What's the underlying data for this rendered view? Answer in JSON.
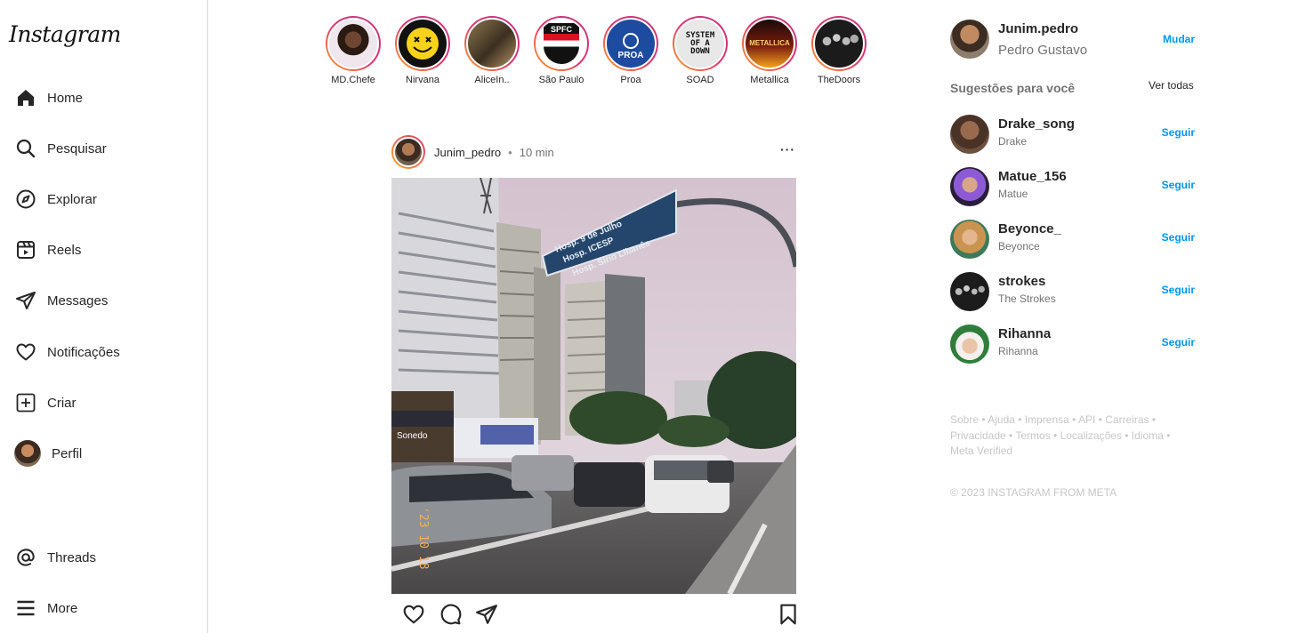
{
  "app": {
    "logo": "Instagram"
  },
  "sidebar": {
    "items": [
      {
        "label": "Home",
        "icon": "home-icon"
      },
      {
        "label": "Pesquisar",
        "icon": "search-icon"
      },
      {
        "label": "Explorar",
        "icon": "compass-icon"
      },
      {
        "label": "Reels",
        "icon": "reels-icon"
      },
      {
        "label": "Messages",
        "icon": "send-icon"
      },
      {
        "label": "Notificações",
        "icon": "heart-icon"
      },
      {
        "label": "Criar",
        "icon": "plus-square-icon"
      },
      {
        "label": "Perfil",
        "icon": "avatar"
      }
    ],
    "bottom": [
      {
        "label": "Threads",
        "icon": "threads-icon"
      },
      {
        "label": "More",
        "icon": "menu-icon"
      }
    ]
  },
  "stories": [
    {
      "name": "MD.Chefe",
      "color": "#e9dfe6"
    },
    {
      "name": "Nirvana",
      "color": "#f7d21a"
    },
    {
      "name": "AliceIn..",
      "color": "#6b5a3a"
    },
    {
      "name": "São Paulo",
      "color": "#d7141c",
      "badge": "SPFC"
    },
    {
      "name": "Proa",
      "color": "#1d4ba0",
      "badge": "PROA"
    },
    {
      "name": "SOAD",
      "color": "#111111",
      "badge": "SYSTEM OF A DOWN"
    },
    {
      "name": "Metallica",
      "color": "#3a0a08",
      "badge": "METALLICA"
    },
    {
      "name": "TheDoors",
      "color": "#2b2b2b"
    }
  ],
  "post": {
    "username": "Junim_pedro",
    "dot": "•",
    "time": "10 min",
    "more": "···",
    "sign_line1": "Hosp. 9 de Julho",
    "sign_line2": "Hosp. ICESP",
    "sign_line3": "Hosp. Sírio Libanês",
    "store_sign": "Sonedo",
    "date_stamp": "'23 10 18"
  },
  "me": {
    "username": "Junim.pedro",
    "name": "Pedro Gustavo",
    "switch_label": "Mudar"
  },
  "suggestions": {
    "title": "Sugestões para você",
    "see_all": "Ver todas",
    "follow_label": "Seguir",
    "items": [
      {
        "username": "Drake_song",
        "name": "Drake",
        "color": "#6b4b3a"
      },
      {
        "username": "Matue_156",
        "name": "Matue",
        "color": "#7a4fc2"
      },
      {
        "username": "Beyonce_",
        "name": "Beyonce",
        "color": "#c99a5d"
      },
      {
        "username": "strokes",
        "name": "The Strokes",
        "color": "#2c2c2c"
      },
      {
        "username": "Rihanna",
        "name": "Rihanna",
        "color": "#2f7d3b"
      }
    ]
  },
  "footer": {
    "links_line1": "Sobre • Ajuda • Imprensa • API • Carreiras •",
    "links_line2": "Privacidade • Termos • Localizações • Idioma •",
    "links_line3": "Meta Verified",
    "copyright": "© 2023 INSTAGRAM FROM META"
  }
}
